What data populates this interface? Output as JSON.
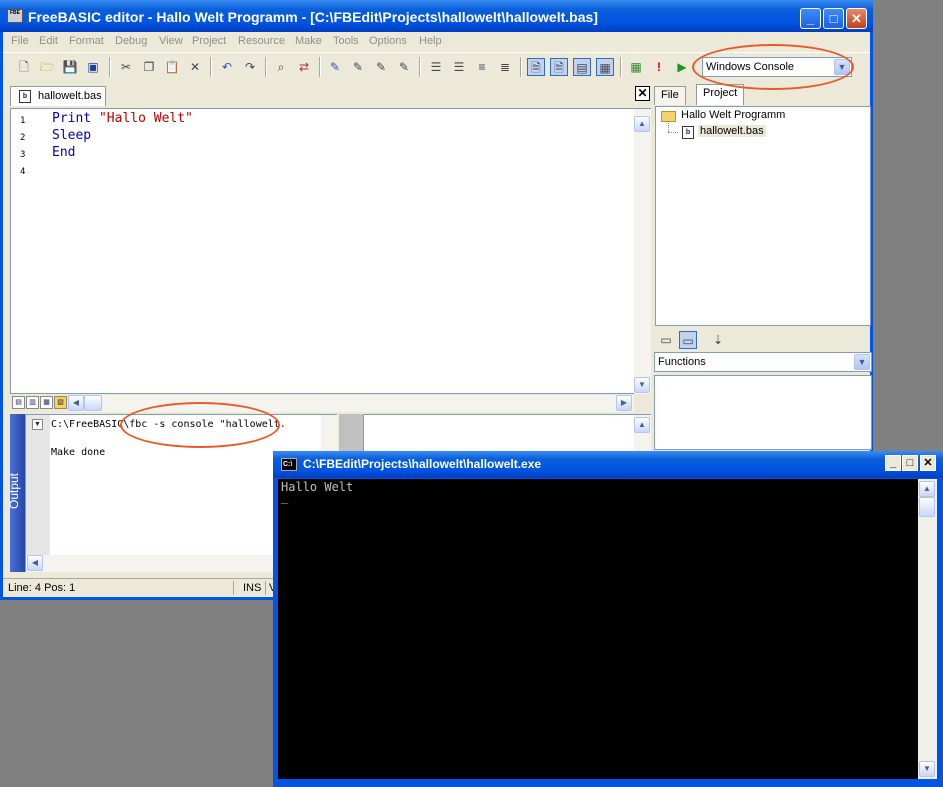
{
  "main_window": {
    "title": "FreeBASIC editor - Hallo Welt Programm - [C:\\FBEdit\\Projects\\hallowelt\\hallowelt.bas]",
    "icon_text": "FBE",
    "min": "_",
    "max": "□",
    "close": "✕"
  },
  "menu": [
    "File",
    "Edit",
    "Format",
    "Debug",
    "View",
    "Project",
    "Resource",
    "Make",
    "Tools",
    "Options",
    "Help"
  ],
  "toolbar": {
    "build_target": "Windows Console"
  },
  "editor": {
    "tab_label": "hallowelt.bas",
    "line_numbers": [
      "1",
      "2",
      "3",
      "4"
    ],
    "code": {
      "line1_kw": "Print",
      "line1_str": "\"Hallo Welt\"",
      "line2": "Sleep",
      "line3": "End"
    }
  },
  "output": {
    "side_label": "Output",
    "command": "C:\\FreeBASIC\\fbc -s console \"hallowelt.",
    "result": "Make done"
  },
  "status": {
    "position": "Line: 4 Pos: 1",
    "mode": "INS",
    "extra": "V"
  },
  "right_panel": {
    "tabs": [
      "File",
      "Project"
    ],
    "project_name": "Hallo Welt Programm",
    "project_file": "hallowelt.bas",
    "functions_label": "Functions"
  },
  "console": {
    "title": "C:\\FBEdit\\Projects\\hallowelt\\hallowelt.exe",
    "icon_text": "C:\\",
    "output_line": "Hallo Welt",
    "cursor": "_",
    "min": "_",
    "max": "□",
    "close": "✕"
  },
  "colors": {
    "title_blue": "#0054e3",
    "annotation_ring": "#e85a28",
    "keyword": "#0000c0",
    "string": "#c00000"
  }
}
